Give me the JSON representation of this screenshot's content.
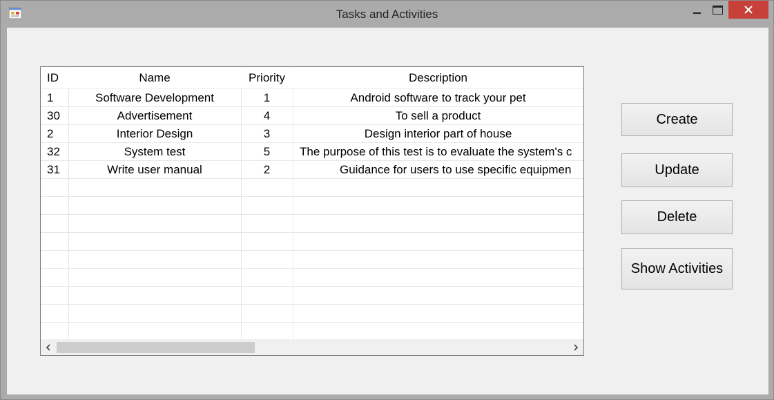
{
  "window": {
    "title": "Tasks and Activities",
    "close_color": "#c7403a"
  },
  "grid": {
    "columns": [
      "ID",
      "Name",
      "Priority",
      "Description"
    ],
    "rows": [
      {
        "id": "1",
        "name": "Software Development",
        "priority": "1",
        "description": "Android software to track your pet"
      },
      {
        "id": "30",
        "name": "Advertisement",
        "priority": "4",
        "description": "To sell a product"
      },
      {
        "id": "2",
        "name": "Interior Design",
        "priority": "3",
        "description": "Design interior part of house"
      },
      {
        "id": "32",
        "name": "System test",
        "priority": "5",
        "description": "The purpose of this test is to evaluate the system's c"
      },
      {
        "id": "31",
        "name": "Write user manual",
        "priority": "2",
        "description": "Guidance for users to use specific equipmen"
      }
    ]
  },
  "buttons": {
    "create": "Create",
    "update": "Update",
    "delete": "Delete",
    "show_activities": "Show Activities"
  },
  "icons": {
    "app": "app-icon",
    "minimize": "minimize-icon",
    "maximize": "maximize-icon",
    "close": "close-icon",
    "scroll_left": "chevron-left-icon",
    "scroll_right": "chevron-right-icon"
  }
}
